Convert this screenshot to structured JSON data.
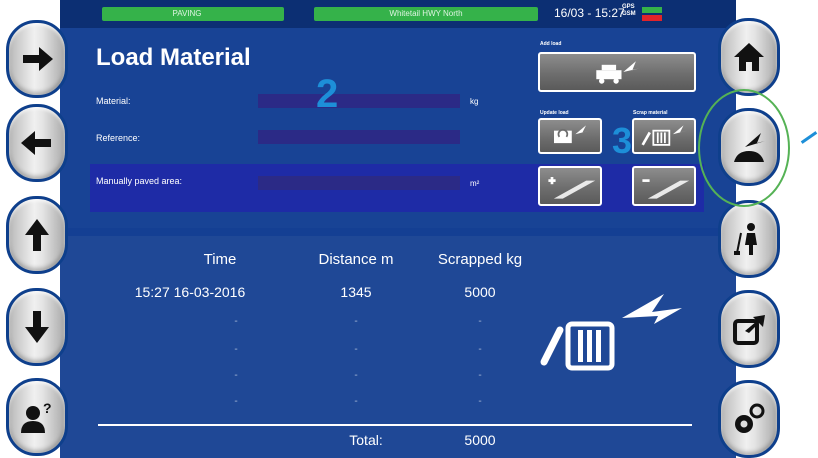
{
  "status_bar": {
    "mode": "PAVING",
    "route": "Whitetail HWY North",
    "datetime": "16/03 - 15:27",
    "gps_label": "GPS",
    "gsm_label": "GSM"
  },
  "colors": {
    "panel": "#143f93",
    "accent": "#35b24a",
    "annotation": "#1d8fd8"
  },
  "page": {
    "title": "Load Material"
  },
  "form": {
    "material_label": "Material:",
    "material_unit": "kg",
    "reference_label": "Reference:",
    "manual_area_label": "Manually paved area:",
    "manual_area_unit": "m²"
  },
  "actions": {
    "add_load_label": "Add load",
    "update_load_label": "Update load",
    "scrap_material_label": "Scrap material"
  },
  "annotations": {
    "a2": "2",
    "a3": "3"
  },
  "table": {
    "headers": [
      "Time",
      "Distance m",
      "Scrapped kg"
    ],
    "rows": [
      [
        "15:27 16-03-2016",
        "1345",
        "5000"
      ],
      [
        "-",
        "-",
        "-"
      ],
      [
        "-",
        "-",
        "-"
      ],
      [
        "-",
        "-",
        "-"
      ],
      [
        "-",
        "-",
        "-"
      ]
    ],
    "total_label": "Total:",
    "total_value": "5000"
  },
  "left_nav": [
    "arrow-right-icon",
    "arrow-left-icon",
    "arrow-up-icon",
    "arrow-down-icon",
    "user-help-icon"
  ],
  "right_nav": [
    "home-icon",
    "load-material-icon",
    "worker-icon",
    "export-icon",
    "settings-icon"
  ]
}
